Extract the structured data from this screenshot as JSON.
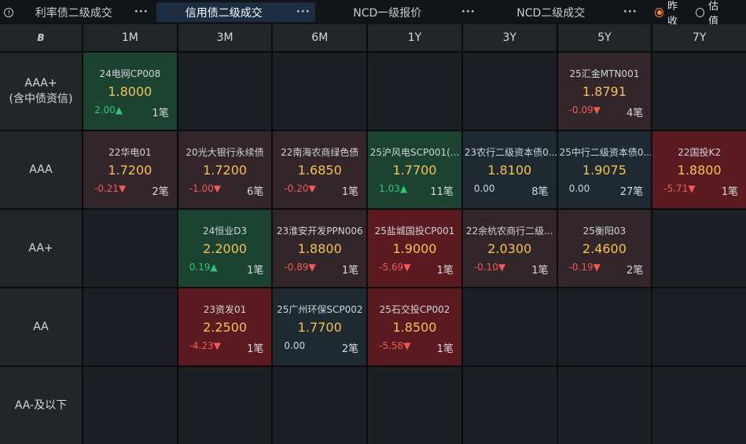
{
  "tabs": [
    {
      "label": "利率债二级成交",
      "active": false,
      "width": 172
    },
    {
      "label": "信用债二级成交",
      "active": true,
      "width": 202
    },
    {
      "label": "NCD一级报价",
      "active": false,
      "width": 206
    },
    {
      "label": "NCD二级成交",
      "active": false,
      "width": 202
    }
  ],
  "tab_more": "···",
  "radios": [
    {
      "label": "昨收",
      "checked": true
    },
    {
      "label": "估值",
      "checked": false
    }
  ],
  "corner_icon": "B",
  "columns": [
    "1M",
    "3M",
    "6M",
    "1Y",
    "3Y",
    "5Y",
    "7Y"
  ],
  "rows": [
    {
      "label": "AAA+\n(含中债资信)",
      "cells": [
        {
          "name": "24电网CP008",
          "rate": "1.8000",
          "change": "2.00▲",
          "count": "1笔",
          "tone": "up",
          "dir": "pos"
        },
        null,
        null,
        null,
        null,
        {
          "name": "25汇金MTN001",
          "rate": "1.8791",
          "change": "-0.09▼",
          "count": "4笔",
          "tone": "down-light",
          "dir": "neg"
        },
        null
      ]
    },
    {
      "label": "AAA",
      "cells": [
        {
          "name": "22华电01",
          "rate": "1.7200",
          "change": "-0.21▼",
          "count": "2笔",
          "tone": "down-light",
          "dir": "neg"
        },
        {
          "name": "20光大银行永续债",
          "rate": "1.7200",
          "change": "-1.00▼",
          "count": "6笔",
          "tone": "down-light",
          "dir": "neg"
        },
        {
          "name": "22南海农商绿色债",
          "rate": "1.6850",
          "change": "-0.20▼",
          "count": "1笔",
          "tone": "down-light",
          "dir": "neg"
        },
        {
          "name": "25沪风电SCP001(...",
          "rate": "1.7700",
          "change": "1.03▲",
          "count": "11笔",
          "tone": "up",
          "dir": "pos"
        },
        {
          "name": "23农行二级资本债0...",
          "rate": "1.8100",
          "change": "0.00",
          "count": "8笔",
          "tone": "flat",
          "dir": "zero"
        },
        {
          "name": "25中行二级资本债0...",
          "rate": "1.9075",
          "change": "0.00",
          "count": "27笔",
          "tone": "flat",
          "dir": "zero"
        },
        {
          "name": "22国投K2",
          "rate": "1.8800",
          "change": "-5.71▼",
          "count": "1笔",
          "tone": "down-heavy",
          "dir": "neg"
        }
      ]
    },
    {
      "label": "AA+",
      "cells": [
        null,
        {
          "name": "24恒业D3",
          "rate": "2.2000",
          "change": "0.19▲",
          "count": "1笔",
          "tone": "up",
          "dir": "pos"
        },
        {
          "name": "23淮安开发PPN006",
          "rate": "1.8800",
          "change": "-0.89▼",
          "count": "1笔",
          "tone": "down-light",
          "dir": "neg"
        },
        {
          "name": "25盐城国投CP001",
          "rate": "1.9000",
          "change": "-5.69▼",
          "count": "1笔",
          "tone": "down-heavy",
          "dir": "neg"
        },
        {
          "name": "22余杭农商行二级...",
          "rate": "2.0300",
          "change": "-0.10▼",
          "count": "1笔",
          "tone": "down-light",
          "dir": "neg"
        },
        {
          "name": "25衡阳03",
          "rate": "2.4600",
          "change": "-0.19▼",
          "count": "2笔",
          "tone": "down-light",
          "dir": "neg"
        },
        null
      ]
    },
    {
      "label": "AA",
      "cells": [
        null,
        {
          "name": "23资发01",
          "rate": "2.2500",
          "change": "-4.23▼",
          "count": "1笔",
          "tone": "down-heavy",
          "dir": "neg"
        },
        {
          "name": "25广州环保SCP002",
          "rate": "1.7700",
          "change": "0.00",
          "count": "2笔",
          "tone": "flat",
          "dir": "zero"
        },
        {
          "name": "25石交投CP002",
          "rate": "1.8500",
          "change": "-5.58▼",
          "count": "1笔",
          "tone": "down-heavy",
          "dir": "neg"
        },
        null,
        null,
        null
      ]
    },
    {
      "label": "AA-及以下",
      "cells": [
        null,
        null,
        null,
        null,
        null,
        null,
        null
      ]
    }
  ]
}
